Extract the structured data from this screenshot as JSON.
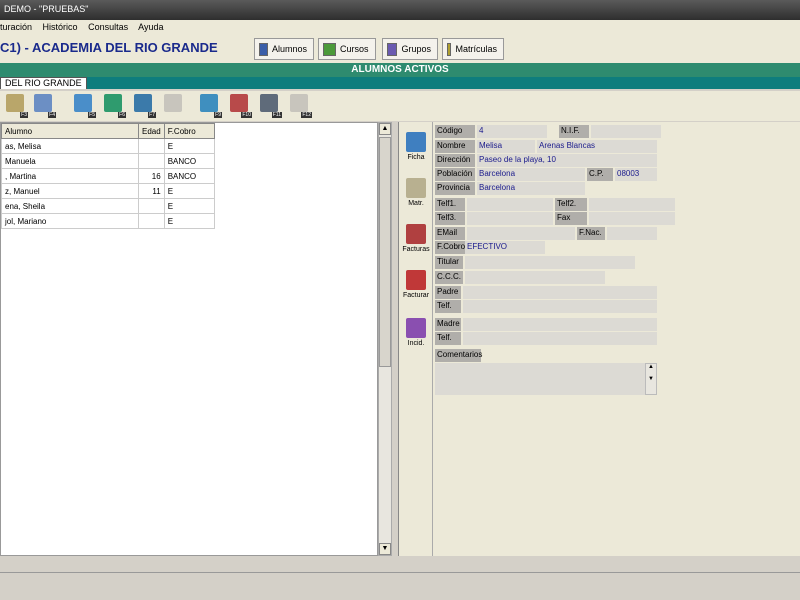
{
  "window": {
    "title": "DEMO - \"PRUEBAS\""
  },
  "menu": {
    "items": [
      "turación",
      "Histórico",
      "Consultas",
      "Ayuda"
    ]
  },
  "header": {
    "title": "C1) - ACADEMIA DEL RIO GRANDE",
    "buttons": [
      "Alumnos",
      "Cursos",
      "Grupos",
      "Matrículas"
    ]
  },
  "section": {
    "title": "ALUMNOS ACTIVOS",
    "tab_label": "DEL RIO GRANDE"
  },
  "toolbar": {
    "keys": [
      "F3",
      "F4",
      "F5",
      "F6",
      "F7",
      "",
      "F9",
      "F10",
      "F11",
      "F12"
    ]
  },
  "grid": {
    "headers": [
      "Alumno",
      "Edad",
      "F.Cobro"
    ],
    "rows": [
      [
        "as, Melisa",
        "",
        "E"
      ],
      [
        "Manuela",
        "",
        "BANCO"
      ],
      [
        ", Martina",
        "16",
        "BANCO"
      ],
      [
        "z, Manuel",
        "11",
        "E"
      ],
      [
        "ena, Sheila",
        "",
        "E"
      ],
      [
        "jol, Mariano",
        "",
        "E"
      ]
    ]
  },
  "side_tabs": [
    "Ficha",
    "Matr.",
    "Facturas",
    "Facturar",
    "Incid."
  ],
  "form": {
    "codigo_label": "Código",
    "codigo": "4",
    "nif_label": "N.I.F.",
    "nombre_label": "Nombre",
    "nombre": "Melisa",
    "apellidos": "Arenas Blancas",
    "direccion_label": "Dirección",
    "direccion": "Paseo de la playa, 10",
    "poblacion_label": "Población",
    "poblacion": "Barcelona",
    "cp_label": "C.P.",
    "cp": "08003",
    "provincia_label": "Provincia",
    "provincia": "Barcelona",
    "telf1_label": "Telf1.",
    "telf2_label": "Telf2.",
    "telf3_label": "Telf3.",
    "fax_label": "Fax",
    "email_label": "EMail",
    "fnac_label": "F.Nac.",
    "fcobro_label": "F.Cobro",
    "fcobro": "EFECTIVO",
    "titular_label": "Titular",
    "ccc_label": "C.C.C.",
    "padre_label": "Padre",
    "telf_padre_label": "Telf.",
    "madre_label": "Madre",
    "telf_madre_label": "Telf.",
    "comentarios_label": "Comentarios"
  }
}
